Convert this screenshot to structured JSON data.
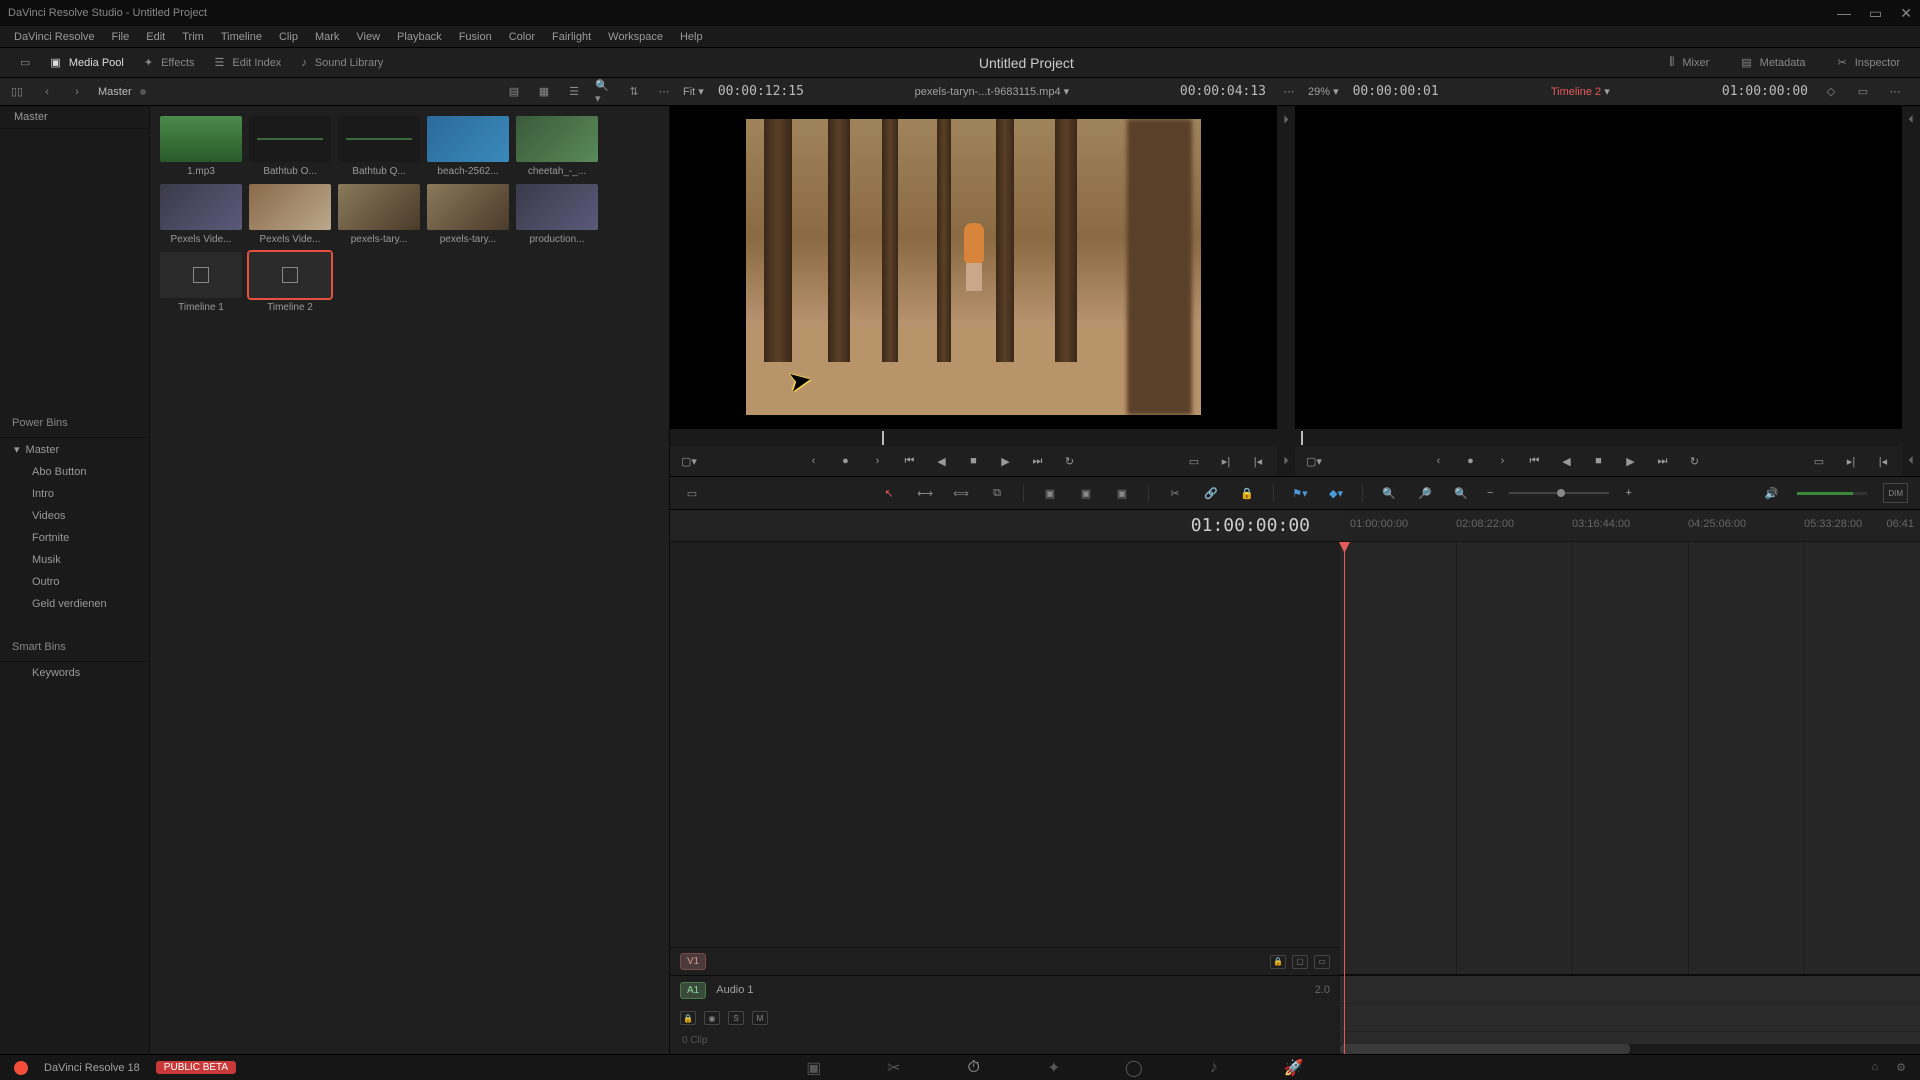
{
  "titlebar": {
    "title": "DaVinci Resolve Studio - Untitled Project"
  },
  "menubar": [
    "DaVinci Resolve",
    "File",
    "Edit",
    "Trim",
    "Timeline",
    "Clip",
    "Mark",
    "View",
    "Playback",
    "Fusion",
    "Color",
    "Fairlight",
    "Workspace",
    "Help"
  ],
  "topbar": {
    "left": [
      {
        "icon": "layout",
        "label": ""
      },
      {
        "icon": "media",
        "label": "Media Pool",
        "active": true
      },
      {
        "icon": "fx",
        "label": "Effects"
      },
      {
        "icon": "index",
        "label": "Edit Index"
      },
      {
        "icon": "sound",
        "label": "Sound Library"
      }
    ],
    "center": "Untitled Project",
    "right": [
      {
        "icon": "mixer",
        "label": "Mixer"
      },
      {
        "icon": "meta",
        "label": "Metadata"
      },
      {
        "icon": "inspector",
        "label": "Inspector"
      }
    ]
  },
  "secondbar": {
    "breadcrumb": "Master",
    "source": {
      "fit": "Fit",
      "duration": "00:00:12:15",
      "name": "pexels-taryn-...t-9683115.mp4",
      "tc": "00:00:04:13"
    },
    "program": {
      "zoom": "29%",
      "duration": "00:00:00:01",
      "name": "Timeline 2",
      "tc": "01:00:00:00"
    }
  },
  "sidebar": {
    "top": "Master",
    "powerbins_label": "Power Bins",
    "power_master": "Master",
    "powerbins": [
      "Abo Button",
      "Intro",
      "Videos",
      "Fortnite",
      "Musik",
      "Outro",
      "Geld verdienen"
    ],
    "smartbins_label": "Smart Bins",
    "smartbins": [
      "Keywords"
    ]
  },
  "clips": [
    {
      "label": "1.mp3",
      "style": "audio"
    },
    {
      "label": "Bathtub O...",
      "style": "audio2"
    },
    {
      "label": "Bathtub Q...",
      "style": "audio2"
    },
    {
      "label": "beach-2562...",
      "style": "vid2"
    },
    {
      "label": "cheetah_-_...",
      "style": "vid3"
    },
    {
      "label": "Pexels Vide...",
      "style": "vid4"
    },
    {
      "label": "Pexels Vide...",
      "style": "vid5"
    },
    {
      "label": "pexels-tary...",
      "style": "vid1"
    },
    {
      "label": "pexels-tary...",
      "style": "vid1"
    },
    {
      "label": "production...",
      "style": "vid4"
    },
    {
      "label": "Timeline 1",
      "style": "tl"
    },
    {
      "label": "Timeline 2",
      "style": "tl",
      "selected": true
    }
  ],
  "timeline": {
    "timecode": "01:00:00:00",
    "ruler": [
      "01:00:00:00",
      "02:08:22:00",
      "03:16:44:00",
      "04:25:06:00",
      "05:33:28:00",
      "06:41"
    ],
    "video_track": "V1",
    "audio_track": {
      "badge": "A1",
      "name": "Audio 1",
      "ch": "2.0",
      "solo": "S",
      "mute": "M",
      "clips": "0 Clip"
    }
  },
  "bottombar": {
    "app": "DaVinci Resolve 18",
    "beta": "PUBLIC BETA"
  }
}
